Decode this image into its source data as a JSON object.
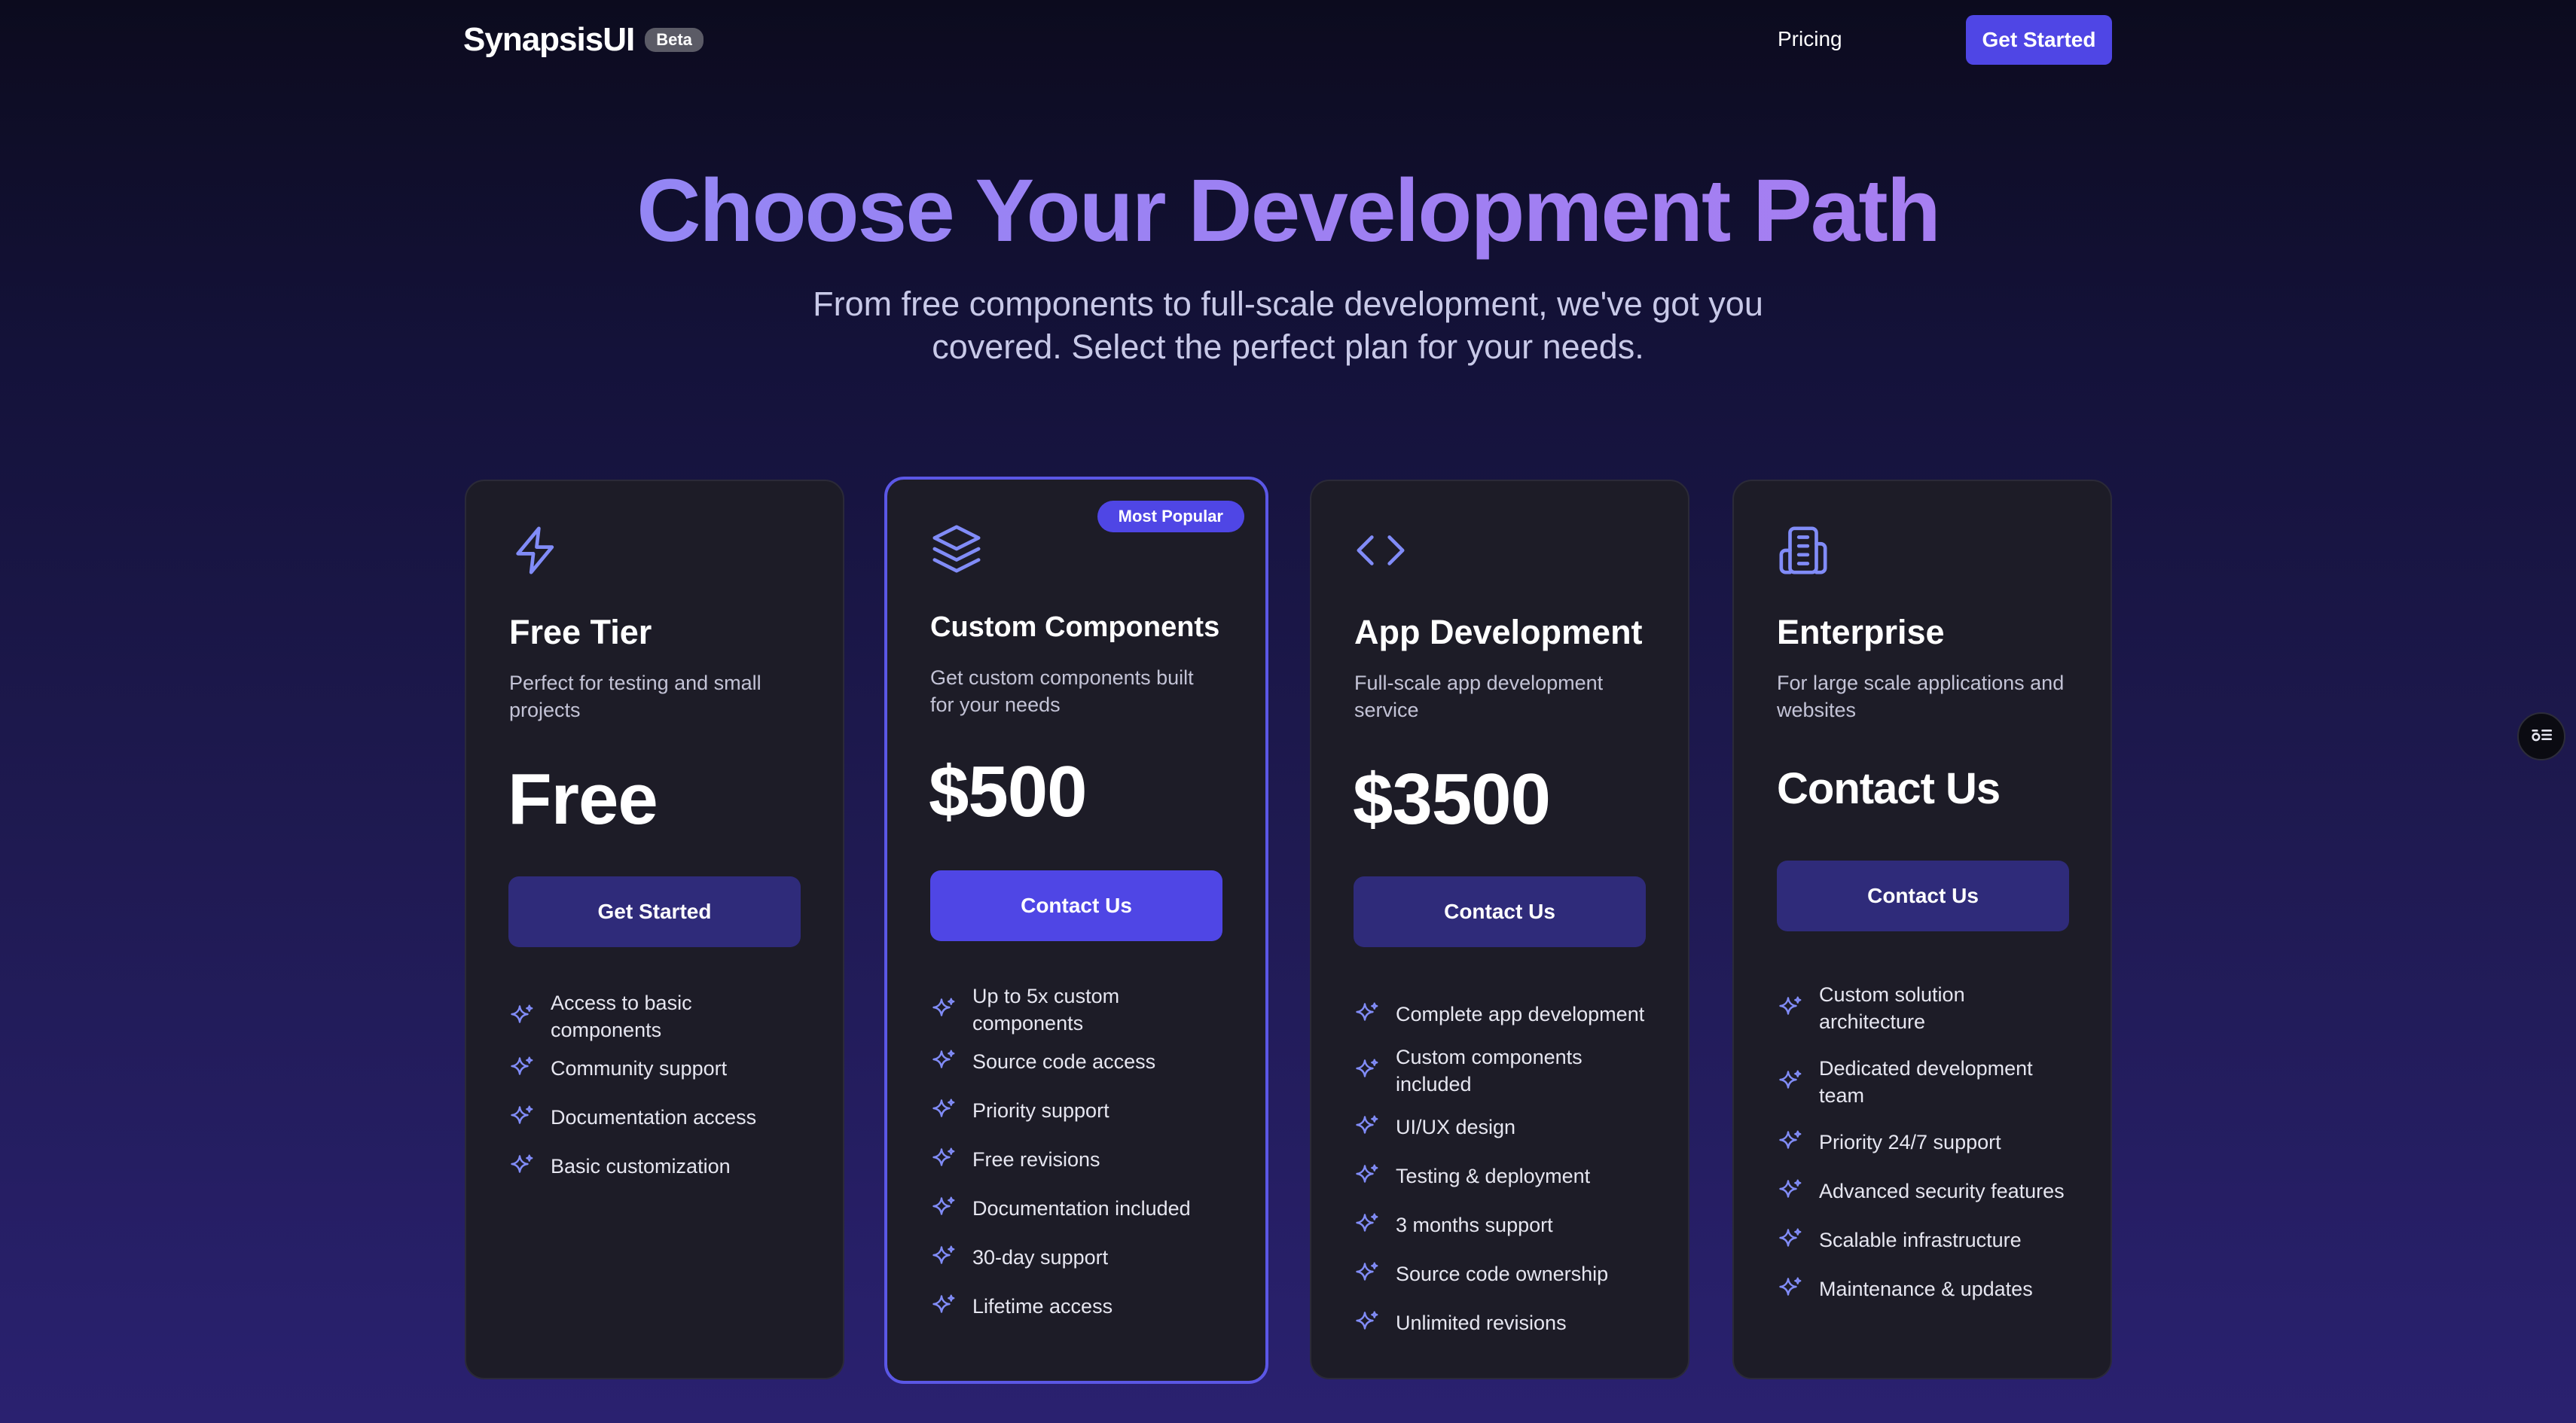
{
  "header": {
    "brand": "SynapsisUI",
    "badge": "Beta",
    "nav_pricing": "Pricing",
    "cta": "Get Started"
  },
  "hero": {
    "title": "Choose Your Development Path",
    "subtitle_line1": "From free components to full-scale development, we've got you",
    "subtitle_line2": "covered. Select the perfect plan for your needs."
  },
  "plans": [
    {
      "icon": "lightning-icon",
      "title": "Free Tier",
      "desc_line1": "Perfect for testing and small",
      "desc_line2": "projects",
      "price": "Free",
      "button": "Get Started",
      "features": [
        "Access to basic components",
        "Community support",
        "Documentation access",
        "Basic customization"
      ]
    },
    {
      "icon": "layers-icon",
      "badge": "Most Popular",
      "title": "Custom Components",
      "desc_line1": "Get custom components built",
      "desc_line2": "for your needs",
      "price": "$500",
      "button": "Contact Us",
      "features": [
        "Up to 5x custom components",
        "Source code access",
        "Priority support",
        "Free revisions",
        "Documentation included",
        "30-day support",
        "Lifetime access"
      ]
    },
    {
      "icon": "code-icon",
      "title": "App Development",
      "desc_line1": "Full-scale app development",
      "desc_line2": "service",
      "price": "$3500",
      "button": "Contact Us",
      "features": [
        "Complete app development",
        "Custom components included",
        "UI/UX design",
        "Testing & deployment",
        "3 months support",
        "Source code ownership",
        "Unlimited revisions"
      ]
    },
    {
      "icon": "building-icon",
      "title": "Enterprise",
      "desc_line1": "For large scale applications and",
      "desc_line2": "websites",
      "price": "Contact Us",
      "button": "Contact Us",
      "features": [
        "Custom solution architecture",
        "Dedicated development team",
        "Priority 24/7 support",
        "Advanced security features",
        "Scalable infrastructure",
        "Maintenance & updates"
      ]
    }
  ],
  "floating_button": {
    "icon": "settings-menu-icon"
  },
  "colors": {
    "accent": "#4f46e5",
    "accent_dark": "#2f2b7a",
    "icon": "#818cf8",
    "card_bg": "#1d1c27"
  }
}
